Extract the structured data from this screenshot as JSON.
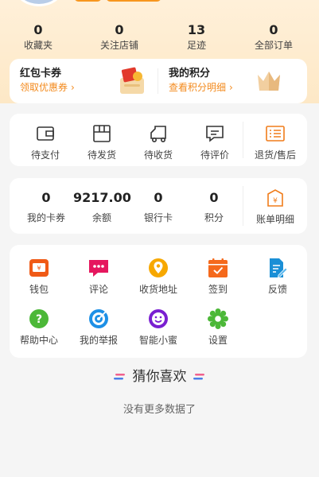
{
  "stats": [
    {
      "value": "0",
      "label": "收藏夹"
    },
    {
      "value": "0",
      "label": "关注店铺"
    },
    {
      "value": "13",
      "label": "足迹"
    },
    {
      "value": "0",
      "label": "全部订单"
    }
  ],
  "promo": {
    "left_title": "红包卡券",
    "left_sub": "领取优惠券",
    "right_title": "我的积分",
    "right_sub": "查看积分明细",
    "chevron": "›"
  },
  "orders": [
    {
      "label": "待支付",
      "icon": "wallet-outline-icon"
    },
    {
      "label": "待发货",
      "icon": "box-icon"
    },
    {
      "label": "待收货",
      "icon": "truck-icon"
    },
    {
      "label": "待评价",
      "icon": "comment-icon"
    },
    {
      "label": "退货/售后",
      "icon": "return-list-icon"
    }
  ],
  "wallet": [
    {
      "value": "0",
      "label": "我的卡券"
    },
    {
      "value": "9217.00",
      "label": "余额"
    },
    {
      "value": "0",
      "label": "银行卡"
    },
    {
      "value": "0",
      "label": "积分"
    }
  ],
  "bill": {
    "label": "账单明细",
    "icon": "bill-icon"
  },
  "tools": [
    {
      "label": "钱包",
      "icon": "wallet-icon",
      "color": "#f05a16"
    },
    {
      "label": "评论",
      "icon": "chat-bubble-icon",
      "color": "#e5175e"
    },
    {
      "label": "收货地址",
      "icon": "location-pin-icon",
      "color": "#f7a800"
    },
    {
      "label": "签到",
      "icon": "calendar-check-icon",
      "color": "#f5691c"
    },
    {
      "label": "反馈",
      "icon": "document-edit-icon",
      "color": "#1a8fd6"
    },
    {
      "label": "帮助中心",
      "icon": "help-icon",
      "color": "#4cb838"
    },
    {
      "label": "我的举报",
      "icon": "target-icon",
      "color": "#1e90e6"
    },
    {
      "label": "智能小蜜",
      "icon": "smile-bot-icon",
      "color": "#7a1fd1"
    },
    {
      "label": "设置",
      "icon": "gear-icon",
      "color": "#4cb838"
    }
  ],
  "guess_title": "猜你喜欢",
  "no_more": "没有更多数据了",
  "colors": {
    "accent": "#f38a1d",
    "orders_accent": "#f07c1a"
  }
}
